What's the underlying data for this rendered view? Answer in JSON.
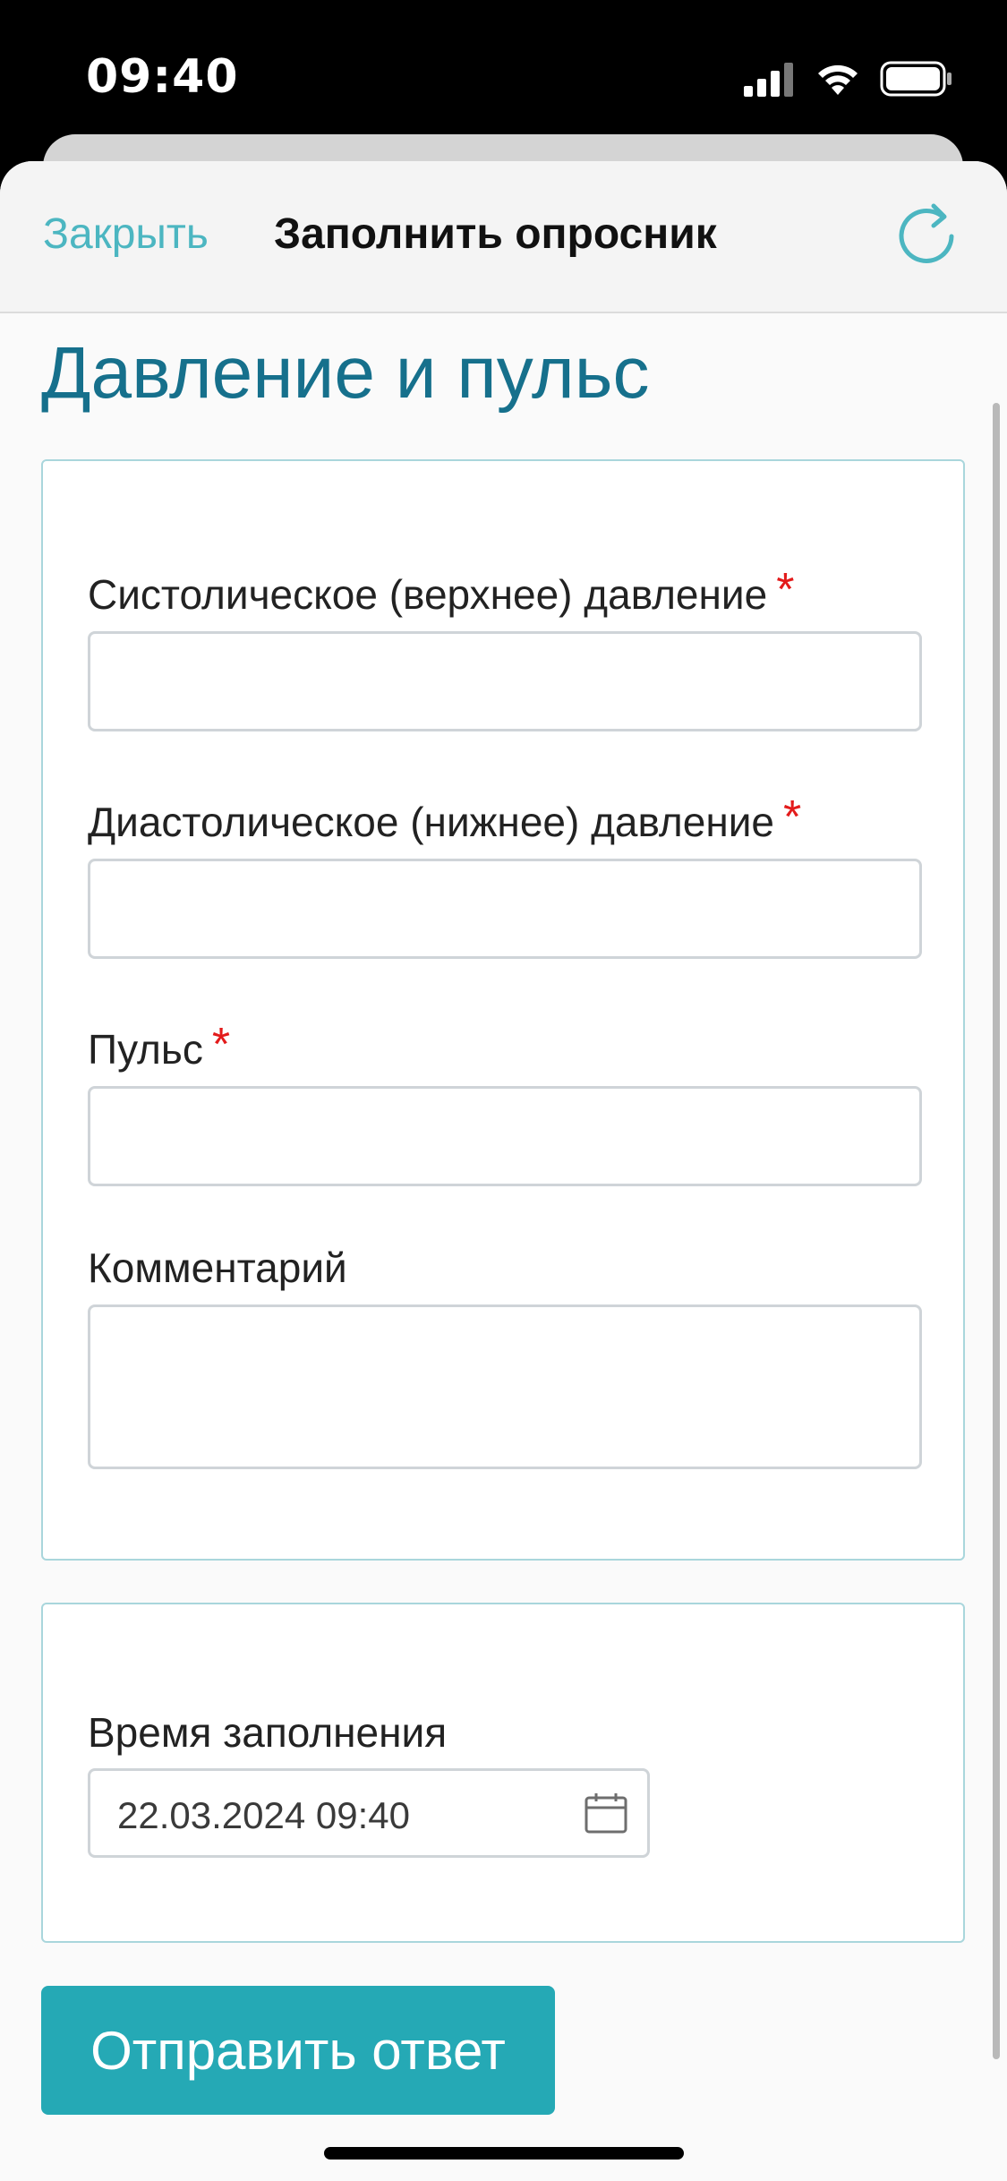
{
  "status_bar": {
    "time": "09:40",
    "icons": [
      "cellular-signal-icon",
      "wifi-icon",
      "battery-icon"
    ]
  },
  "nav": {
    "close_label": "Закрыть",
    "title": "Заполнить опросник",
    "refresh_icon": "refresh-icon"
  },
  "page": {
    "title": "Давление и пульс"
  },
  "form": {
    "systolic": {
      "label": "Систолическое (верхнее) давление",
      "required_mark": "*",
      "value": ""
    },
    "diastolic": {
      "label": "Диастолическое (нижнее) давление",
      "required_mark": "*",
      "value": ""
    },
    "pulse": {
      "label": "Пульс",
      "required_mark": "*",
      "value": ""
    },
    "comment": {
      "label": "Комментарий",
      "value": ""
    },
    "fill_time": {
      "label": "Время заполнения",
      "value": "22.03.2024 09:40",
      "icon": "calendar-icon"
    }
  },
  "actions": {
    "submit_label": "Отправить ответ"
  },
  "colors": {
    "accent": "#25a9b5",
    "title": "#16708c",
    "link": "#4cb6c1",
    "required": "#e31b1b",
    "card_border": "#a9d6dc"
  }
}
